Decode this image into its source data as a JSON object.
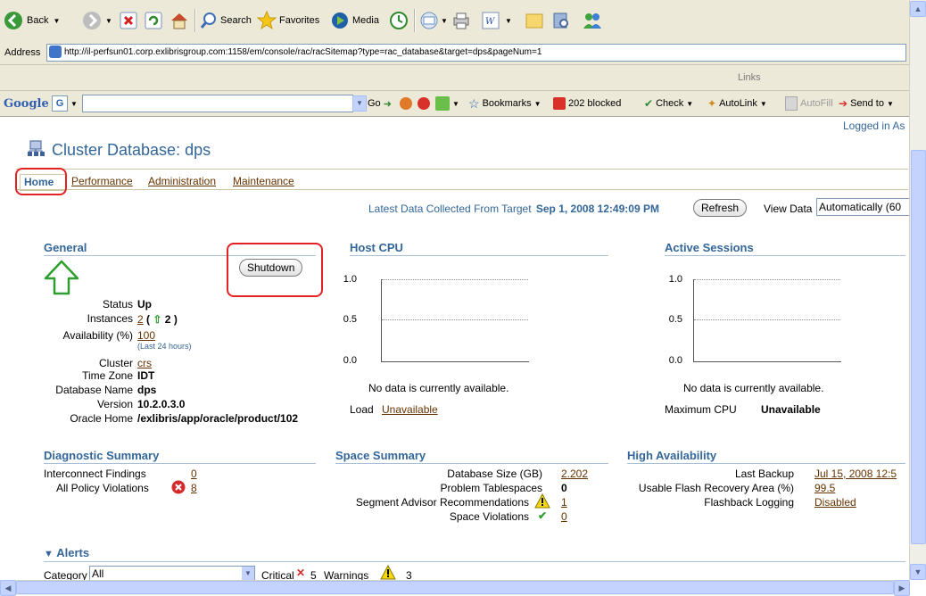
{
  "browser": {
    "toolbar": {
      "back": "Back",
      "search": "Search",
      "favorites": "Favorites",
      "media": "Media"
    },
    "address": {
      "label": "Address",
      "url": "http://il-perfsun01.corp.exlibrisgroup.com:1158/em/console/rac/racSitemap?type=rac_database&target=dps&pageNum=1"
    },
    "links_label": "Links",
    "google": {
      "logo": "Google",
      "go": "Go",
      "bookmarks": "Bookmarks",
      "blocked": "202 blocked",
      "check": "Check",
      "autolink": "AutoLink",
      "autofill": "AutoFill",
      "sendto": "Send to"
    }
  },
  "page": {
    "logged_in": "Logged in As",
    "title": "Cluster Database: dps",
    "tabs": [
      "Home",
      "Performance",
      "Administration",
      "Maintenance"
    ],
    "collected_label": "Latest Data Collected From Target",
    "collected_time": "Sep 1, 2008 12:49:09 PM",
    "refresh": "Refresh",
    "view_data_label": "View Data",
    "view_data_value": "Automatically (60"
  },
  "general": {
    "heading": "General",
    "shutdown": "Shutdown",
    "status_label": "Status",
    "status_value": "Up",
    "instances_label": "Instances",
    "instances_value": "2",
    "instances_open": "(",
    "instances_up": "2",
    "instances_close": ")",
    "availability_label": "Availability (%)",
    "availability_value": "100",
    "availability_note": "(Last 24 hours)",
    "cluster_label": "Cluster",
    "cluster_value": "crs",
    "timezone_label": "Time Zone",
    "timezone_value": "IDT",
    "dbname_label": "Database Name",
    "dbname_value": "dps",
    "version_label": "Version",
    "version_value": "10.2.0.3.0",
    "oraclehome_label": "Oracle Home",
    "oraclehome_value": "/exlibris/app/oracle/product/102"
  },
  "host_cpu": {
    "heading": "Host CPU",
    "y_ticks": [
      "1.0",
      "0.5",
      "0.0"
    ],
    "no_data": "No data is currently available.",
    "load_label": "Load",
    "load_value": "Unavailable"
  },
  "active_sessions": {
    "heading": "Active Sessions",
    "y_ticks": [
      "1.0",
      "0.5",
      "0.0"
    ],
    "no_data": "No data is currently available.",
    "maxcpu_label": "Maximum CPU",
    "maxcpu_value": "Unavailable"
  },
  "diagnostic": {
    "heading": "Diagnostic Summary",
    "interconnect_label": "Interconnect Findings",
    "interconnect_value": "0",
    "policy_label": "All Policy Violations",
    "policy_value": "8"
  },
  "space": {
    "heading": "Space Summary",
    "dbsize_label": "Database Size (GB)",
    "dbsize_value": "2.202",
    "problem_label": "Problem Tablespaces",
    "problem_value": "0",
    "segment_label": "Segment Advisor Recommendations",
    "segment_value": "1",
    "violations_label": "Space Violations",
    "violations_value": "0"
  },
  "ha": {
    "heading": "High Availability",
    "backup_label": "Last Backup",
    "backup_value": "Jul 15, 2008 12:5",
    "flash_label": "Usable Flash Recovery Area (%)",
    "flash_value": "99.5",
    "logging_label": "Flashback Logging",
    "logging_value": "Disabled"
  },
  "alerts": {
    "heading": "Alerts",
    "category_label": "Category",
    "category_value": "All",
    "critical_label": "Critical",
    "critical_value": "5",
    "warnings_label": "Warnings",
    "warnings_value": "3"
  },
  "colors": {
    "accent": "#336699",
    "link": "#663300",
    "highlight": "#e32222",
    "status_up": "#2e9e2e"
  }
}
